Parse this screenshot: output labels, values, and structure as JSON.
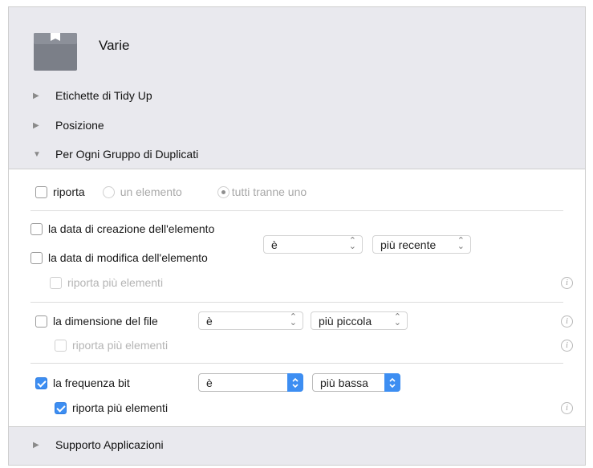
{
  "app": {
    "title": "Varie"
  },
  "sections": {
    "tidy_tags": "Etichette di Tidy Up",
    "position": "Posizione",
    "duplicates": "Per Ogni Gruppo di Duplicati",
    "app_support": "Supporto Applicazioni"
  },
  "report": {
    "label": "riporta",
    "option_one": "un elemento",
    "option_all_but_one": "tutti tranne uno"
  },
  "date_group": {
    "creation_label": "la data di creazione dell'elemento",
    "modification_label": "la data di modifica dell'elemento",
    "operator": "è",
    "value": "più recente",
    "report_more": "riporta più elementi"
  },
  "size_group": {
    "label": "la dimensione del file",
    "operator": "è",
    "value": "più piccola",
    "report_more": "riporta più elementi"
  },
  "bitrate_group": {
    "label": "la frequenza bit",
    "operator": "è",
    "value": "più bassa",
    "report_more": "riporta più elementi"
  },
  "info_glyph": "i",
  "colors": {
    "accent": "#3d8ef2",
    "header_bg": "#e9e9ee"
  }
}
